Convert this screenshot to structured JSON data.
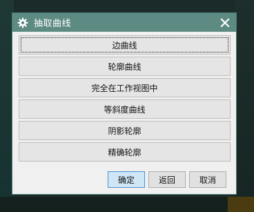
{
  "dialog": {
    "title": "抽取曲线",
    "options": [
      "边曲线",
      "轮廓曲线",
      "完全在工作视图中",
      "等斜度曲线",
      "阴影轮廓",
      "精确轮廓"
    ],
    "buttons": {
      "ok": "确定",
      "back": "返回",
      "cancel": "取消"
    }
  },
  "icons": {
    "title": "gear-icon",
    "close": "close-icon"
  },
  "colors": {
    "titlebar": "#5d8a83",
    "dialog_bg": "#f0f0f0",
    "ok_button": "#cfe6f6",
    "ok_border": "#4a90d0",
    "background": "#1b2b29"
  }
}
